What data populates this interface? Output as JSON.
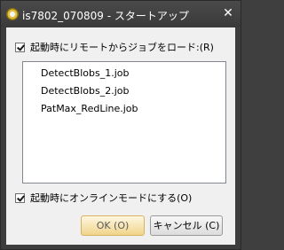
{
  "window": {
    "title": "is7802_070809 - スタートアップ",
    "close_glyph": "✕",
    "app_icon": "app-logo-icon"
  },
  "load_jobs_checkbox": {
    "label": "起動時にリモートからジョブをロード:(R)",
    "checked": true
  },
  "job_list": {
    "items": [
      "DetectBlobs_1.job",
      "DetectBlobs_2.job",
      "PatMax_RedLine.job"
    ]
  },
  "online_checkbox": {
    "label": "起動時にオンラインモードにする(O)",
    "checked": true
  },
  "buttons": {
    "ok": "OK (O)",
    "cancel": "キャンセル (C)"
  }
}
